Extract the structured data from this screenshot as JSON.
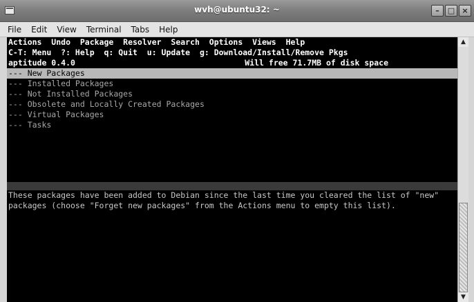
{
  "window": {
    "title": "wvh@ubuntu32: ~"
  },
  "menubar": {
    "items": [
      "File",
      "Edit",
      "View",
      "Terminal",
      "Tabs",
      "Help"
    ]
  },
  "aptitude": {
    "menu": "Actions  Undo  Package  Resolver  Search  Options  Views  Help",
    "keys": "C-T: Menu  ?: Help  q: Quit  u: Update  g: Download/Install/Remove Pkgs",
    "version": "aptitude 0.4.0",
    "disk": "Will free 71.7MB of disk space",
    "groups": [
      "--- New Packages",
      "--- Installed Packages",
      "--- Not Installed Packages",
      "--- Obsolete and Locally Created Packages",
      "--- Virtual Packages",
      "--- Tasks"
    ],
    "description": [
      "These packages have been added to Debian since the last time you cleared the list of \"new\"",
      "packages (choose \"Forget new packages\" from the Actions menu to empty this list)."
    ]
  },
  "scrollbar": {
    "up_glyph": "▲",
    "down_glyph": "▼"
  }
}
